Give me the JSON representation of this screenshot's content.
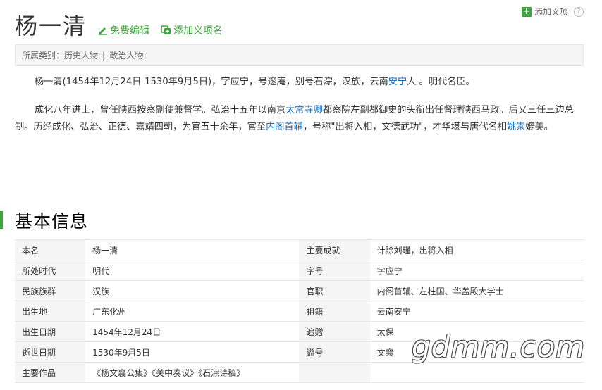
{
  "top_add": {
    "label": "添加义项",
    "help": "?"
  },
  "header": {
    "title": "杨一清",
    "edit_label": "免费编辑",
    "add_label": "添加义项名"
  },
  "category": {
    "prefix": "所属类别：",
    "items": [
      "历史人物",
      "政治人物"
    ],
    "separator": "|"
  },
  "intro": {
    "p1": {
      "a": "杨一清(1454年12月24日-1530年9月5日)，字应宁，号邃庵，别号石淙，汉族，云南",
      "link1": "安宁",
      "b": "人 。明代名臣。"
    },
    "p2": {
      "a": "成化八年进士，曾任陕西按察副使兼督学。弘治十五年以南京",
      "link1": "太常寺卿",
      "b": "都察院左副都御史的头衔出任督理陕西马政。后又三任三边总制。历经成化、弘治、正德、嘉靖四朝，为官五十余年，官至",
      "link2": "内阁首辅",
      "c": "，号称\"出将入相，文德武功\"，才华堪与唐代名相",
      "link3": "姚崇",
      "d": "媲美。"
    }
  },
  "basic_info": {
    "title": "基本信息",
    "rows": [
      {
        "k1": "本名",
        "v1": "杨一清",
        "k2": "主要成就",
        "v2": "计除刘瑾，出将入相"
      },
      {
        "k1": "所处时代",
        "v1": "明代",
        "k2": "字号",
        "v2": "字应宁"
      },
      {
        "k1": "民族族群",
        "v1": "汉族",
        "k2": "官职",
        "v2": "内阁首辅、左柱国、华盖殿大学士"
      },
      {
        "k1": "出生地",
        "v1": "广东化州",
        "k2": "祖籍",
        "v2": "云南安宁"
      },
      {
        "k1": "出生日期",
        "v1": "1454年12月24日",
        "k2": "追赠",
        "v2": "太保"
      },
      {
        "k1": "逝世日期",
        "v1": "1530年9月5日",
        "k2": "谥号",
        "v2": "文襄"
      },
      {
        "k1": "主要作品",
        "v1": "《杨文襄公集》《关中奏议》《石淙诗稿》",
        "k2": "",
        "v2": ""
      }
    ]
  },
  "watermark": "gdmm.com",
  "colors": {
    "accent": "#3aa63a",
    "link": "#136ec2"
  },
  "icons": {
    "edit": "pencil-icon",
    "add": "add-entry-icon",
    "plus": "plus-square-icon",
    "help": "help-icon"
  }
}
